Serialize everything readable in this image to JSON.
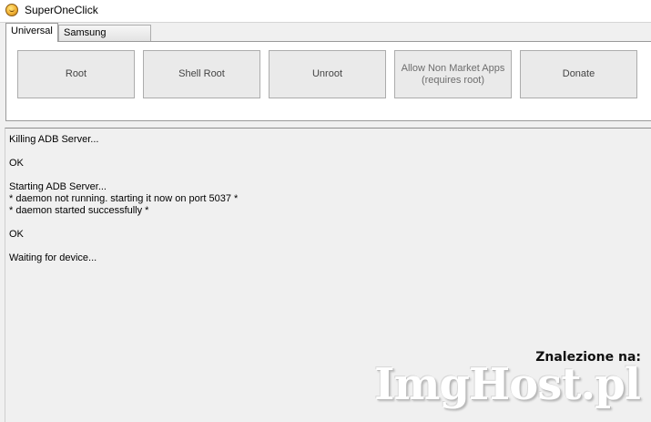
{
  "window": {
    "title": "SuperOneClick"
  },
  "tabs": [
    {
      "label": "Universal",
      "active": true
    },
    {
      "label": "Samsung Captivate",
      "active": false
    }
  ],
  "buttons": [
    {
      "label": "Root"
    },
    {
      "label": "Shell Root"
    },
    {
      "label": "Unroot"
    },
    {
      "label": "Allow Non Market Apps\n(requires root)"
    },
    {
      "label": "Donate"
    }
  ],
  "log": {
    "text": "Killing ADB Server...\n\nOK\n\nStarting ADB Server...\n* daemon not running. starting it now on port 5037 *\n* daemon started successfully *\n\nOK\n\nWaiting for device..."
  },
  "watermark": {
    "caption": "Znalezione na:",
    "logo": "ImgHost.pl"
  }
}
